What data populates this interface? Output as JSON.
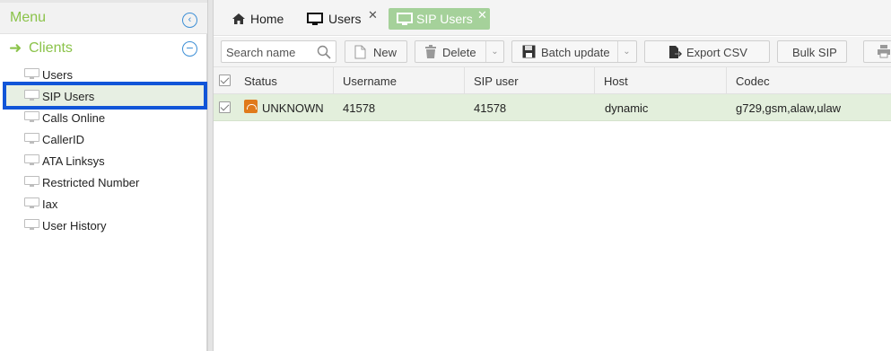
{
  "sidebar": {
    "menu_title": "Menu",
    "section_title": "Clients",
    "items": [
      {
        "label": "Users"
      },
      {
        "label": "SIP Users"
      },
      {
        "label": "Calls Online"
      },
      {
        "label": "CallerID"
      },
      {
        "label": "ATA Linksys"
      },
      {
        "label": "Restricted Number"
      },
      {
        "label": "Iax"
      },
      {
        "label": "User History"
      }
    ],
    "selected_item": "SIP Users"
  },
  "tabs": [
    {
      "label": "Home",
      "icon": "home-icon",
      "closable": false
    },
    {
      "label": "Users",
      "icon": "monitor-icon",
      "closable": true
    },
    {
      "label": "SIP Users",
      "icon": "monitor-icon",
      "closable": true,
      "active": true
    }
  ],
  "toolbar": {
    "search_placeholder": "Search name",
    "new_label": "New",
    "delete_label": "Delete",
    "batch_update_label": "Batch update",
    "export_csv_label": "Export CSV",
    "bulk_sip_label": "Bulk SIP"
  },
  "grid": {
    "columns": [
      "Status",
      "Username",
      "SIP user",
      "Host",
      "Codec"
    ],
    "rows": [
      {
        "status": "UNKNOWN",
        "username": "41578",
        "sip_user": "41578",
        "host": "dynamic",
        "codec": "g729,gsm,alaw,ulaw",
        "checked": true
      }
    ]
  },
  "colors": {
    "accent_green": "#8bc34a",
    "active_tab": "#a5d19a",
    "selection_border": "#1155d8",
    "row_selected": "#e3efdc",
    "status_orange": "#e07a1b"
  }
}
